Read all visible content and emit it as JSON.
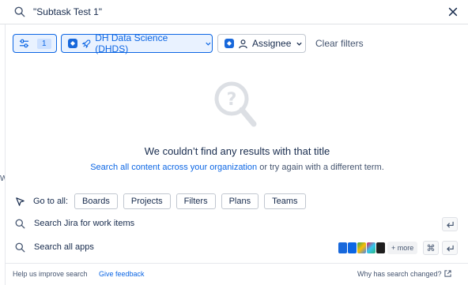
{
  "search": {
    "value": "\"Subtask Test 1\"",
    "search_icon": "search-icon",
    "close_icon": "close-icon"
  },
  "background_fragment": "W",
  "filters": {
    "filter_count": "1",
    "project_label": "DH Data Science (DHDS)",
    "assignee_label": "Assignee",
    "clear_label": "Clear filters"
  },
  "empty_state": {
    "title": "We couldn’t find any results with that title",
    "link_text": "Search all content across your organization",
    "suffix_text": " or try again with a different term."
  },
  "goto": {
    "label": "Go to all:",
    "items": [
      "Boards",
      "Projects",
      "Filters",
      "Plans",
      "Teams"
    ]
  },
  "rows": {
    "jira_label": "Search Jira for work items",
    "apps_label": "Search all apps",
    "more_label": "+ more"
  },
  "footer": {
    "improve_text": "Help us improve search",
    "feedback_link": "Give feedback",
    "changed_link": "Why has search changed?"
  },
  "colors": {
    "accent": "#0c66e4",
    "selected_bg": "#e9f2ff",
    "text": "#172b4d",
    "subtle": "#44546f"
  }
}
